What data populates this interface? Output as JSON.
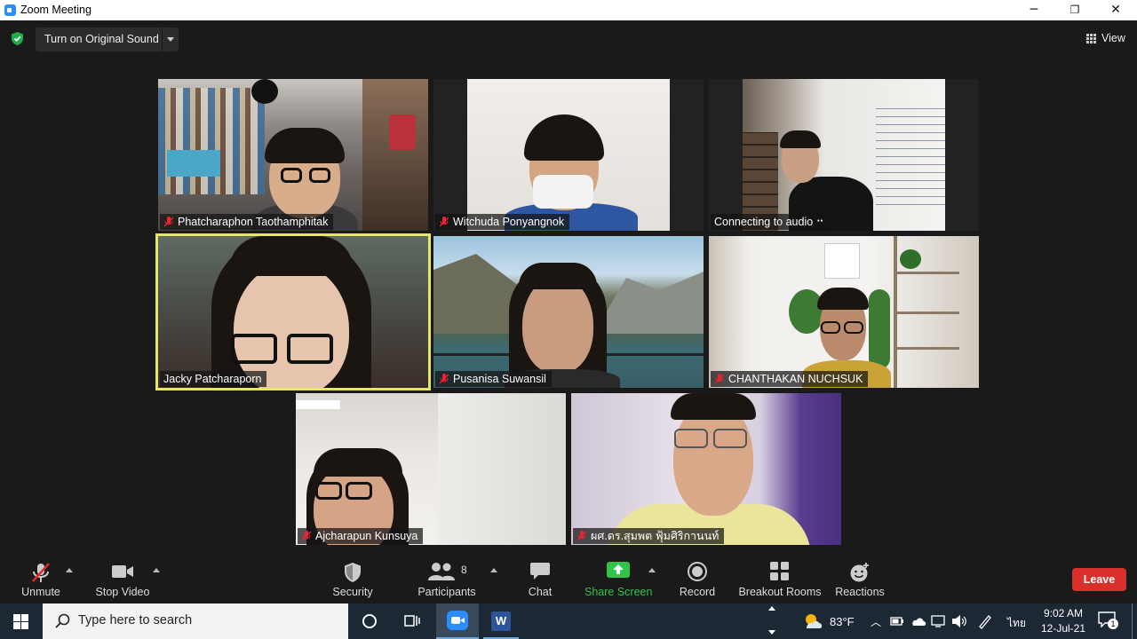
{
  "window": {
    "title": "Zoom Meeting",
    "minimize": "─",
    "restore": "❐",
    "close": "✕"
  },
  "topbar": {
    "sound_label": "Turn on Original Sound",
    "view_label": "View"
  },
  "participants_tiles": [
    {
      "name": "Phatcharaphon Taothamphitak"
    },
    {
      "name": "Witchuda Ponyangnok"
    },
    {
      "name": "Connecting to audio ⠒"
    },
    {
      "name": "Jacky Patcharaporn"
    },
    {
      "name": "Pusanisa Suwansil"
    },
    {
      "name": "CHANTHAKAN NUCHSUK"
    },
    {
      "name": "Ajcharapun Kunsuya"
    },
    {
      "name": "ผศ.ดร.สุมพต ฟุ้มศิริกานนท์"
    }
  ],
  "toolbar": {
    "unmute": "Unmute",
    "stop_video": "Stop Video",
    "security": "Security",
    "participants": "Participants",
    "participants_count": "8",
    "chat": "Chat",
    "share_screen": "Share Screen",
    "record": "Record",
    "breakout": "Breakout Rooms",
    "reactions": "Reactions",
    "leave": "Leave"
  },
  "taskbar": {
    "search_placeholder": "Type here to search",
    "temperature": "83°F",
    "language": "ไทย",
    "time": "9:02 AM",
    "date": "12-Jul-21",
    "notif_count": "1"
  },
  "colors": {
    "accent_green": "#1fae4b",
    "leave_red": "#d9302c",
    "active_speaker": "#e7e663",
    "share_green": "#2fc34a"
  }
}
